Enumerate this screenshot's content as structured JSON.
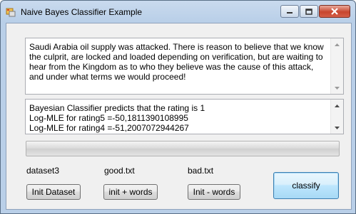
{
  "window": {
    "title": "Naive Bayes Classifier Example",
    "controls": {
      "minimize": "minimize",
      "maximize": "maximize",
      "close": "close"
    }
  },
  "input_text": "Saudi Arabia oil supply was attacked. There is reason to believe that we know the culprit, are locked and loaded depending on verification, but are waiting to hear from the Kingdom as to who they believe was the cause of this attack, and under what terms we would proceed!",
  "output_text": "Bayesian Classifier predicts that the rating is 1\nLog-MLE for rating5 =-50,1811390108995\nLog-MLE for rating4 =-51,2007072944267",
  "progress": {
    "value": 0
  },
  "labels": {
    "dataset": "dataset3",
    "good": "good.txt",
    "bad": "bad.txt"
  },
  "buttons": {
    "init_dataset": "Init Dataset",
    "init_plus_words": "init + words",
    "init_minus_words": "Init - words",
    "classify": "classify"
  },
  "colors": {
    "titlebar": "#c9daee",
    "client_bg": "#f0f0f0",
    "close_button": "#c8452e"
  }
}
